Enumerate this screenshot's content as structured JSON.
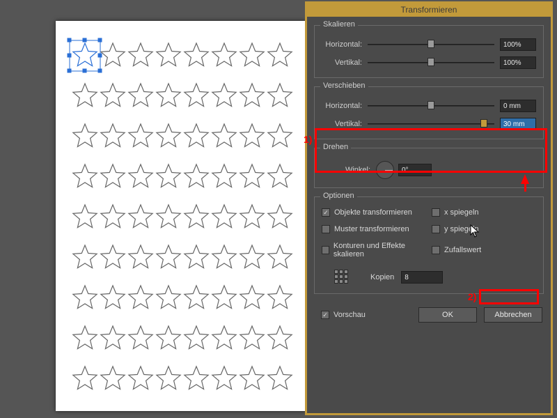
{
  "dialog": {
    "title": "Transformieren",
    "sections": {
      "scale": {
        "legend": "Skalieren",
        "h_label": "Horizontal:",
        "h_value": "100%",
        "v_label": "Vertikal:",
        "v_value": "100%"
      },
      "move": {
        "legend": "Verschieben",
        "h_label": "Horizontal:",
        "h_value": "0 mm",
        "v_label": "Vertikal:",
        "v_value": "30 mm"
      },
      "rotate": {
        "legend": "Drehen",
        "a_label": "Winkel:",
        "a_value": "0°"
      },
      "options": {
        "legend": "Optionen",
        "transform_objects": "Objekte transformieren",
        "transform_objects_checked": true,
        "transform_patterns": "Muster transformieren",
        "transform_patterns_checked": false,
        "scale_strokes": "Konturen und Effekte skalieren",
        "scale_strokes_checked": false,
        "reflect_x": "x spiegeln",
        "reflect_x_checked": false,
        "reflect_y": "y spiegeln",
        "reflect_y_checked": false,
        "random": "Zufallswert",
        "random_checked": false,
        "copies_label": "Kopien",
        "copies_value": "8"
      }
    },
    "preview_label": "Vorschau",
    "preview_checked": true,
    "ok": "OK",
    "cancel": "Abbrechen"
  },
  "annotations": {
    "label1": "1)",
    "label2": "2)"
  },
  "canvas": {
    "star_rows": 9,
    "star_cols": 8,
    "selected_star": {
      "row": 0,
      "col": 0
    }
  }
}
